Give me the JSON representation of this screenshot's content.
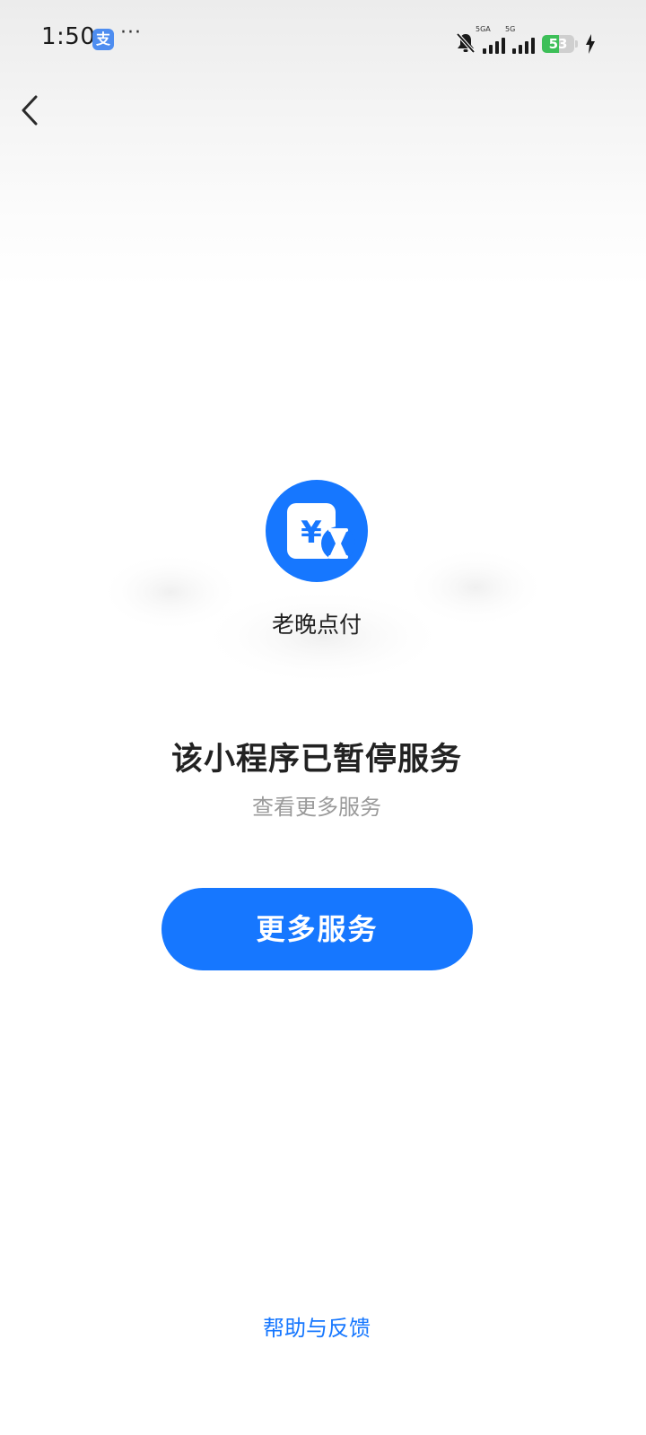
{
  "status_bar": {
    "time": "1:50",
    "app_badge": "支",
    "more": "···",
    "signal_1_tag": "5GA",
    "signal_2_tag": "5G",
    "battery_level": "53",
    "battery_fraction": 0.53
  },
  "nav": {
    "back_icon": "chevron-left-icon"
  },
  "app": {
    "logo_icon": "yen-hourglass-icon",
    "logo_symbol": "¥",
    "name": "老晚点付",
    "accent_color": "#1677ff"
  },
  "message": {
    "headline": "该小程序已暂停服务",
    "subline": "查看更多服务"
  },
  "actions": {
    "more_services_label": "更多服务",
    "help_label": "帮助与反馈"
  }
}
